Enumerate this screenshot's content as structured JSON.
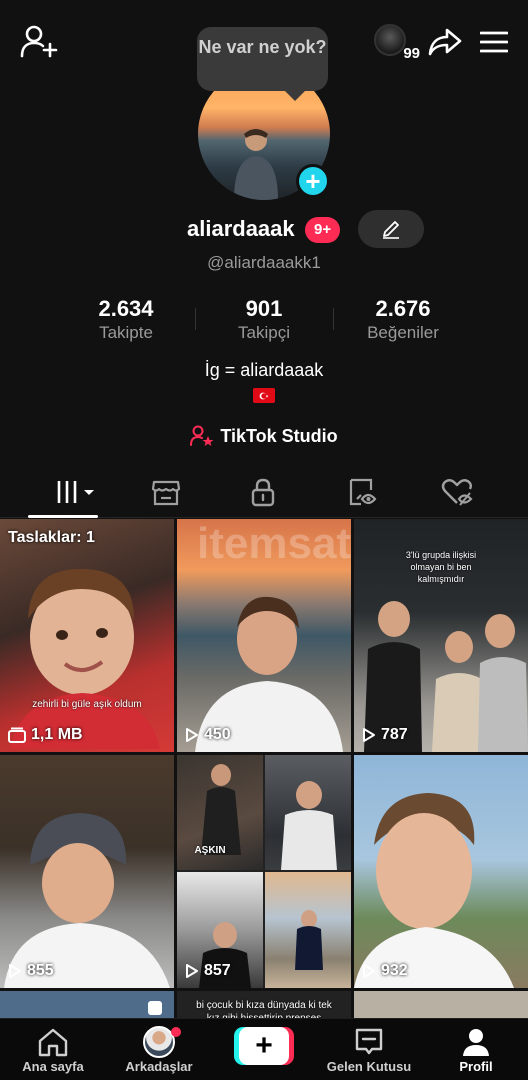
{
  "profile": {
    "bubble_text": "Ne var ne yok?",
    "username": "aliardaaak",
    "notif_badge": "9+",
    "handle": "@aliardaaakk1",
    "bio": "İg = aliardaaak",
    "studio_label": "TikTok Studio",
    "plus": "+"
  },
  "top": {
    "avatar_count": "99"
  },
  "stats": [
    {
      "value": "2.634",
      "label": "Takipte"
    },
    {
      "value": "901",
      "label": "Takipçi"
    },
    {
      "value": "2.676",
      "label": "Beğeniler"
    }
  ],
  "grid": {
    "watermark": "itemsatis",
    "tiles": [
      {
        "kind": "draft",
        "top_label": "Taslaklar: 1",
        "caption": "zehirli bi güle aşık oldum",
        "views": "1,1 MB"
      },
      {
        "kind": "video",
        "caption": "",
        "views": "450"
      },
      {
        "kind": "video",
        "caption": "3'lü grupda ilişkisi olmayan bi ben kalmışmıdır",
        "views": "787"
      },
      {
        "kind": "video",
        "caption": "",
        "views": "855"
      },
      {
        "kind": "video",
        "caption": "AŞKIN",
        "views": "857"
      },
      {
        "kind": "video",
        "caption": "",
        "views": "932"
      }
    ],
    "partial_caption": "bi çocuk bi kıza dünyada ki tek kız gibi hissettirip prenses"
  },
  "nav": [
    {
      "label": "Ana sayfa"
    },
    {
      "label": "Arkadaşlar"
    },
    {
      "label": ""
    },
    {
      "label": "Gelen Kutusu"
    },
    {
      "label": "Profil"
    }
  ],
  "colors": {
    "accent_pink": "#fe2c55",
    "accent_cyan": "#25f4ee",
    "plus_blue": "#20d5ec",
    "background": "#111111"
  },
  "icons": {
    "top_left": "add-friend-icon",
    "top_right": [
      "avatar-icon",
      "share-icon",
      "menu-icon"
    ],
    "tabs": [
      "videos-grid-icon",
      "shop-icon",
      "lock-icon",
      "tagged-icon",
      "liked-icon"
    ]
  }
}
